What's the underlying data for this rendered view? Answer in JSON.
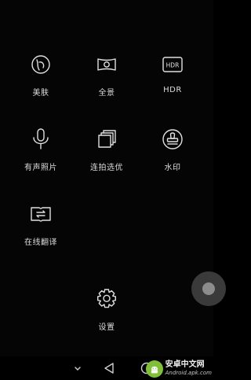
{
  "menu": {
    "items": [
      {
        "label": "美肤",
        "icon": "beauty-face-icon"
      },
      {
        "label": "全景",
        "icon": "panorama-icon"
      },
      {
        "label": "HDR",
        "icon": "hdr-icon",
        "badge": "HDR"
      },
      {
        "label": "有声照片",
        "icon": "microphone-icon"
      },
      {
        "label": "连拍选优",
        "icon": "burst-photos-icon"
      },
      {
        "label": "水印",
        "icon": "watermark-stamp-icon"
      },
      {
        "label": "在线翻译",
        "icon": "translate-book-icon"
      },
      {
        "label": "设置",
        "icon": "gear-icon"
      }
    ]
  },
  "navbar": {
    "back": "back-triangle-icon",
    "home": "home-circle-icon",
    "down": "chevron-down-icon"
  },
  "watermark": {
    "cn": "安卓中文网",
    "en": "Android.apk.com"
  },
  "colors": {
    "background": "#050505",
    "icon_stroke": "#e0e0e0",
    "label": "#dcdcdc",
    "watermark_green": "#7fbf3a"
  }
}
